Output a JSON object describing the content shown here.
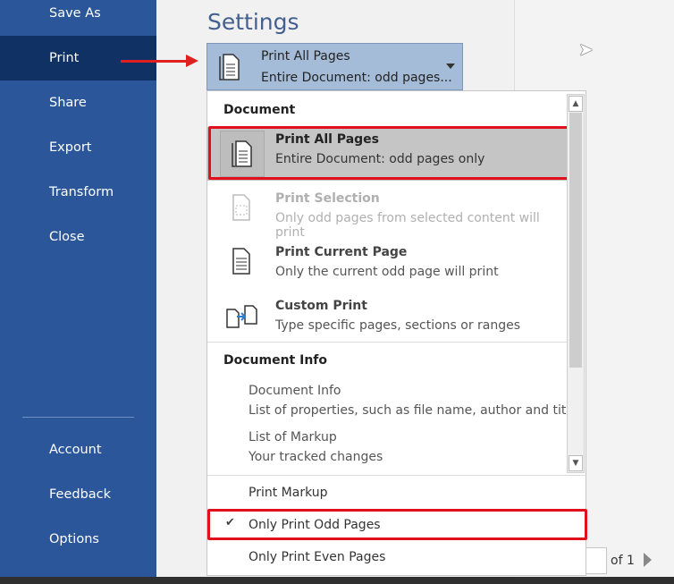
{
  "sidebar": {
    "items": [
      {
        "label": "Save As"
      },
      {
        "label": "Print",
        "selected": true
      },
      {
        "label": "Share"
      },
      {
        "label": "Export"
      },
      {
        "label": "Transform"
      },
      {
        "label": "Close"
      }
    ],
    "bottom_items": [
      {
        "label": "Account"
      },
      {
        "label": "Feedback"
      },
      {
        "label": "Options"
      }
    ]
  },
  "settings": {
    "title": "Settings",
    "combo": {
      "line1": "Print All Pages",
      "line2": "Entire Document: odd pages..."
    }
  },
  "menu": {
    "section_document": "Document",
    "items": [
      {
        "title": "Print All Pages",
        "subtitle": "Entire Document: odd pages only",
        "selected": true
      },
      {
        "title": "Print Selection",
        "subtitle": "Only odd pages from selected content will print",
        "disabled": true
      },
      {
        "title": "Print Current Page",
        "subtitle": "Only the current odd page will print"
      },
      {
        "title": "Custom Print",
        "subtitle": "Type specific pages, sections or ranges"
      }
    ],
    "section_info": "Document Info",
    "info_items": [
      {
        "title": "Document Info",
        "subtitle": "List of properties, such as file name, author and title"
      },
      {
        "title": "List of Markup",
        "subtitle": "Your tracked changes"
      }
    ],
    "options": [
      {
        "label": "Print Markup",
        "checked": false
      },
      {
        "label": "Only Print Odd Pages",
        "checked": true
      },
      {
        "label": "Only Print Even Pages",
        "checked": false
      }
    ],
    "check_glyph": "✔"
  },
  "pager": {
    "of_label": "of 1"
  },
  "colors": {
    "sidebar": "#2b579a",
    "sidebar_selected": "#0f3163",
    "highlight": "#e0101c",
    "combo": "#a5bcd9"
  }
}
